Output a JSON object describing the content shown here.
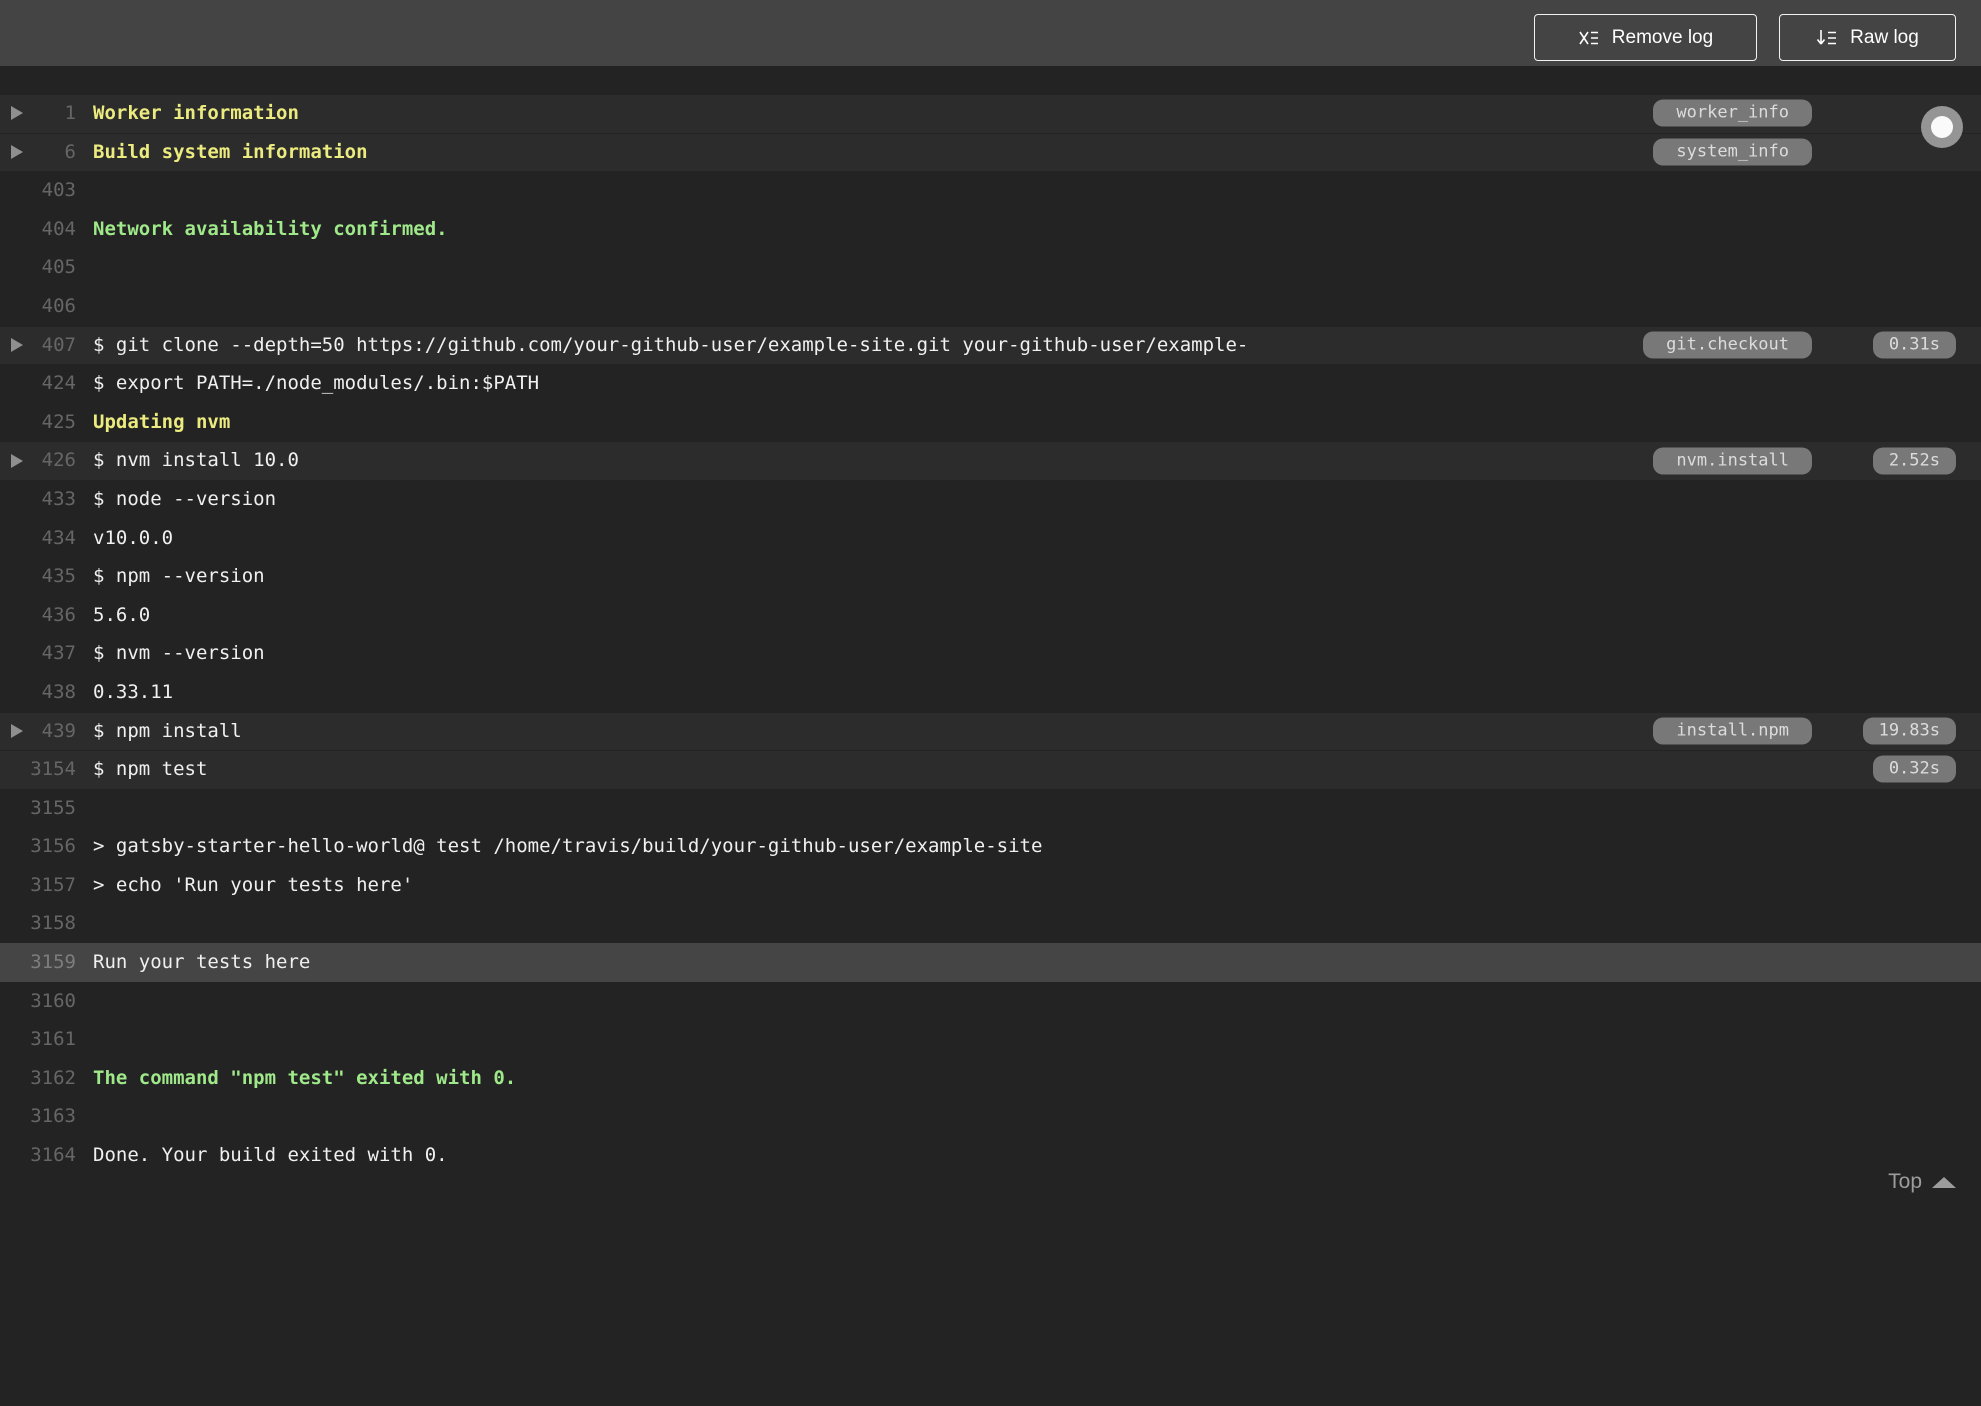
{
  "toolbar": {
    "remove_log": "Remove log",
    "raw_log": "Raw log"
  },
  "footer": {
    "top_label": "Top"
  },
  "colors": {
    "toolbar_bg": "#444444",
    "log_bg": "#232323",
    "fold_row_bg": "#2c2c2c",
    "highlight_row_bg": "#454545",
    "text": "#f0f0f0",
    "line_number": "#666666",
    "fold_title_yellow": "#eceb7f",
    "success_green": "#9fe98a",
    "pill_bg": "#787878"
  },
  "log": {
    "rows": [
      {
        "num": "1",
        "text": "Worker information",
        "color": "yellow",
        "fold": true,
        "arrow": true,
        "tag": "worker_info"
      },
      {
        "num": "6",
        "text": "Build system information",
        "color": "yellow",
        "fold": true,
        "arrow": true,
        "tag": "system_info"
      },
      {
        "num": "403",
        "text": ""
      },
      {
        "num": "404",
        "text": "Network availability confirmed.",
        "color": "green"
      },
      {
        "num": "405",
        "text": ""
      },
      {
        "num": "406",
        "text": ""
      },
      {
        "num": "407",
        "text": "$ git clone --depth=50 https://github.com/your-github-user/example-site.git your-github-user/example-",
        "fold": true,
        "arrow": true,
        "tag": "git.checkout",
        "time": "0.31s"
      },
      {
        "num": "424",
        "text": "$ export PATH=./node_modules/.bin:$PATH"
      },
      {
        "num": "425",
        "text": "Updating nvm",
        "color": "yellow"
      },
      {
        "num": "426",
        "text": "$ nvm install 10.0",
        "fold": true,
        "arrow": true,
        "tag": "nvm.install",
        "time": "2.52s"
      },
      {
        "num": "433",
        "text": "$ node --version"
      },
      {
        "num": "434",
        "text": "v10.0.0"
      },
      {
        "num": "435",
        "text": "$ npm --version"
      },
      {
        "num": "436",
        "text": "5.6.0"
      },
      {
        "num": "437",
        "text": "$ nvm --version"
      },
      {
        "num": "438",
        "text": "0.33.11"
      },
      {
        "num": "439",
        "text": "$ npm install",
        "fold": true,
        "arrow": true,
        "tag": "install.npm",
        "time": "19.83s"
      },
      {
        "num": "3154",
        "text": "$ npm test",
        "fold": true,
        "time": "0.32s"
      },
      {
        "num": "3155",
        "text": ""
      },
      {
        "num": "3156",
        "text": "> gatsby-starter-hello-world@ test /home/travis/build/your-github-user/example-site"
      },
      {
        "num": "3157",
        "text": "> echo 'Run your tests here'"
      },
      {
        "num": "3158",
        "text": ""
      },
      {
        "num": "3159",
        "text": "Run your tests here",
        "highlight": true
      },
      {
        "num": "3160",
        "text": ""
      },
      {
        "num": "3161",
        "text": ""
      },
      {
        "num": "3162",
        "text": "The command \"npm test\" exited with 0.",
        "color": "green"
      },
      {
        "num": "3163",
        "text": ""
      },
      {
        "num": "3164",
        "text": "Done. Your build exited with 0."
      }
    ]
  }
}
